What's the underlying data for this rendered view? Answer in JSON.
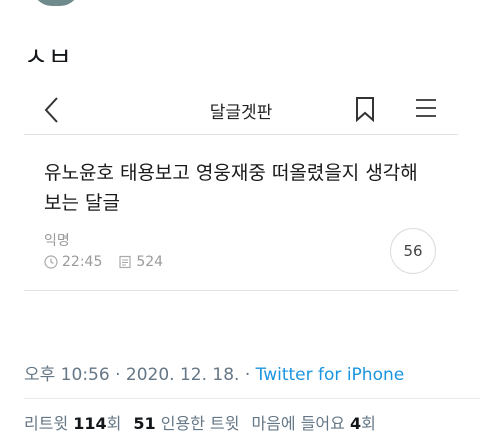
{
  "tweet": {
    "text_partial": "ㅅㅂ",
    "timestamp": "오후 10:56 · 2020. 12. 18.",
    "source": "Twitter for iPhone"
  },
  "card": {
    "board_title": "달글겟판",
    "post_title": "유노윤호 태용보고 영웅재중 떠올렸을지 생각해보는 달글",
    "author": "익명",
    "time": "22:45",
    "views": "524",
    "comment_count": "56"
  },
  "stats": {
    "retweets_label": "리트윗",
    "retweets_count": "114",
    "retweets_unit": "회",
    "quotes_count": "51",
    "quotes_label": "인용한 트윗",
    "likes_label": "마음에 들어요",
    "likes_count": "4",
    "likes_unit": "회"
  }
}
